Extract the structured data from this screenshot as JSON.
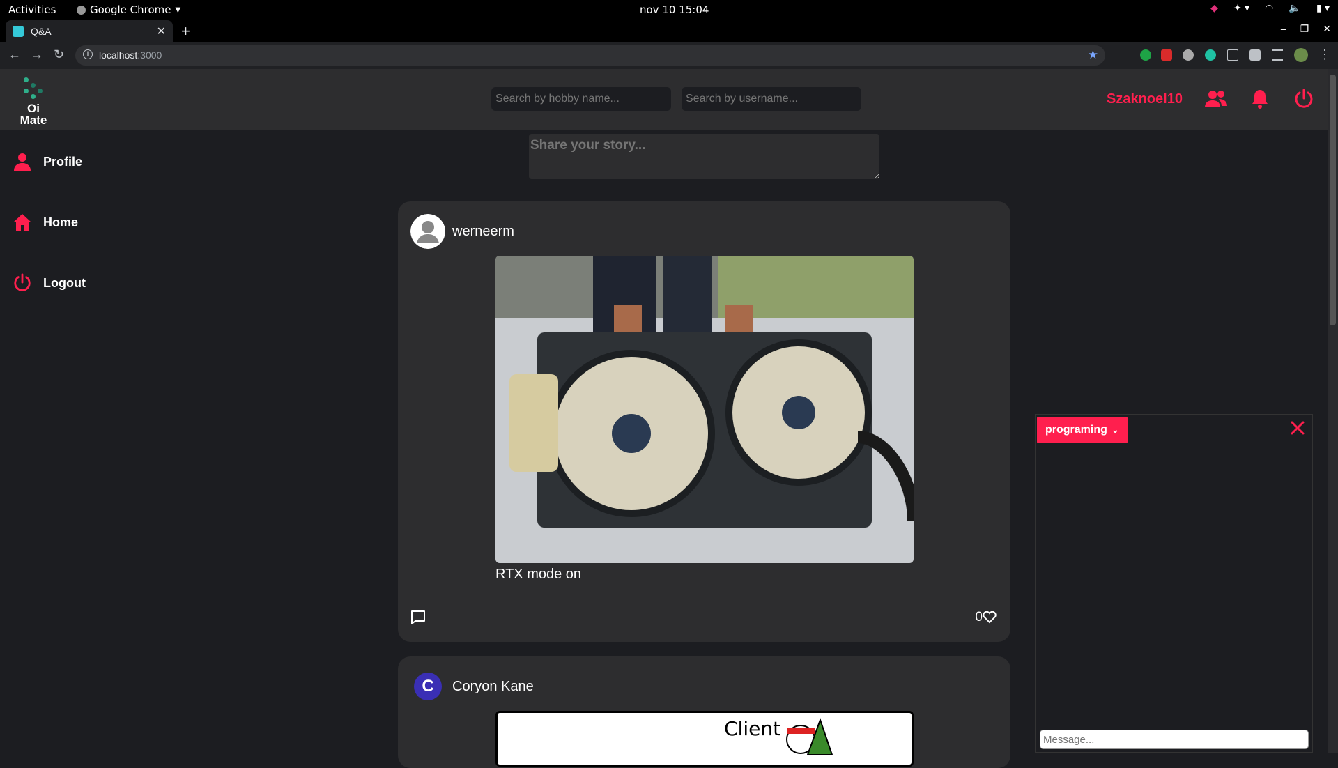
{
  "os": {
    "activities": "Activities",
    "app_name": "Google Chrome",
    "clock": "nov 10  15:04"
  },
  "browser": {
    "tab_title": "Q&A",
    "url_host": "localhost",
    "url_port": ":3000"
  },
  "header": {
    "logo_line1": "Oi",
    "logo_line2": "Mate",
    "hobby_search_placeholder": "Search by hobby name...",
    "user_search_placeholder": "Search by username...",
    "username": "Szaknoel10",
    "accent_color": "#ff1f4e"
  },
  "sidebar": {
    "items": [
      {
        "label": "Profile",
        "icon": "person-icon"
      },
      {
        "label": "Home",
        "icon": "home-icon"
      },
      {
        "label": "Logout",
        "icon": "power-icon"
      }
    ]
  },
  "feed": {
    "story_placeholder": "Share your story...",
    "posts": [
      {
        "author": "werneerm",
        "caption": "RTX mode on",
        "likes": "0",
        "avatar": "default-avatar"
      },
      {
        "author": "Coryon Kane",
        "avatar_letter": "C",
        "image_text": "Client"
      }
    ]
  },
  "chat": {
    "room": "programing",
    "message_placeholder": "Message..."
  }
}
